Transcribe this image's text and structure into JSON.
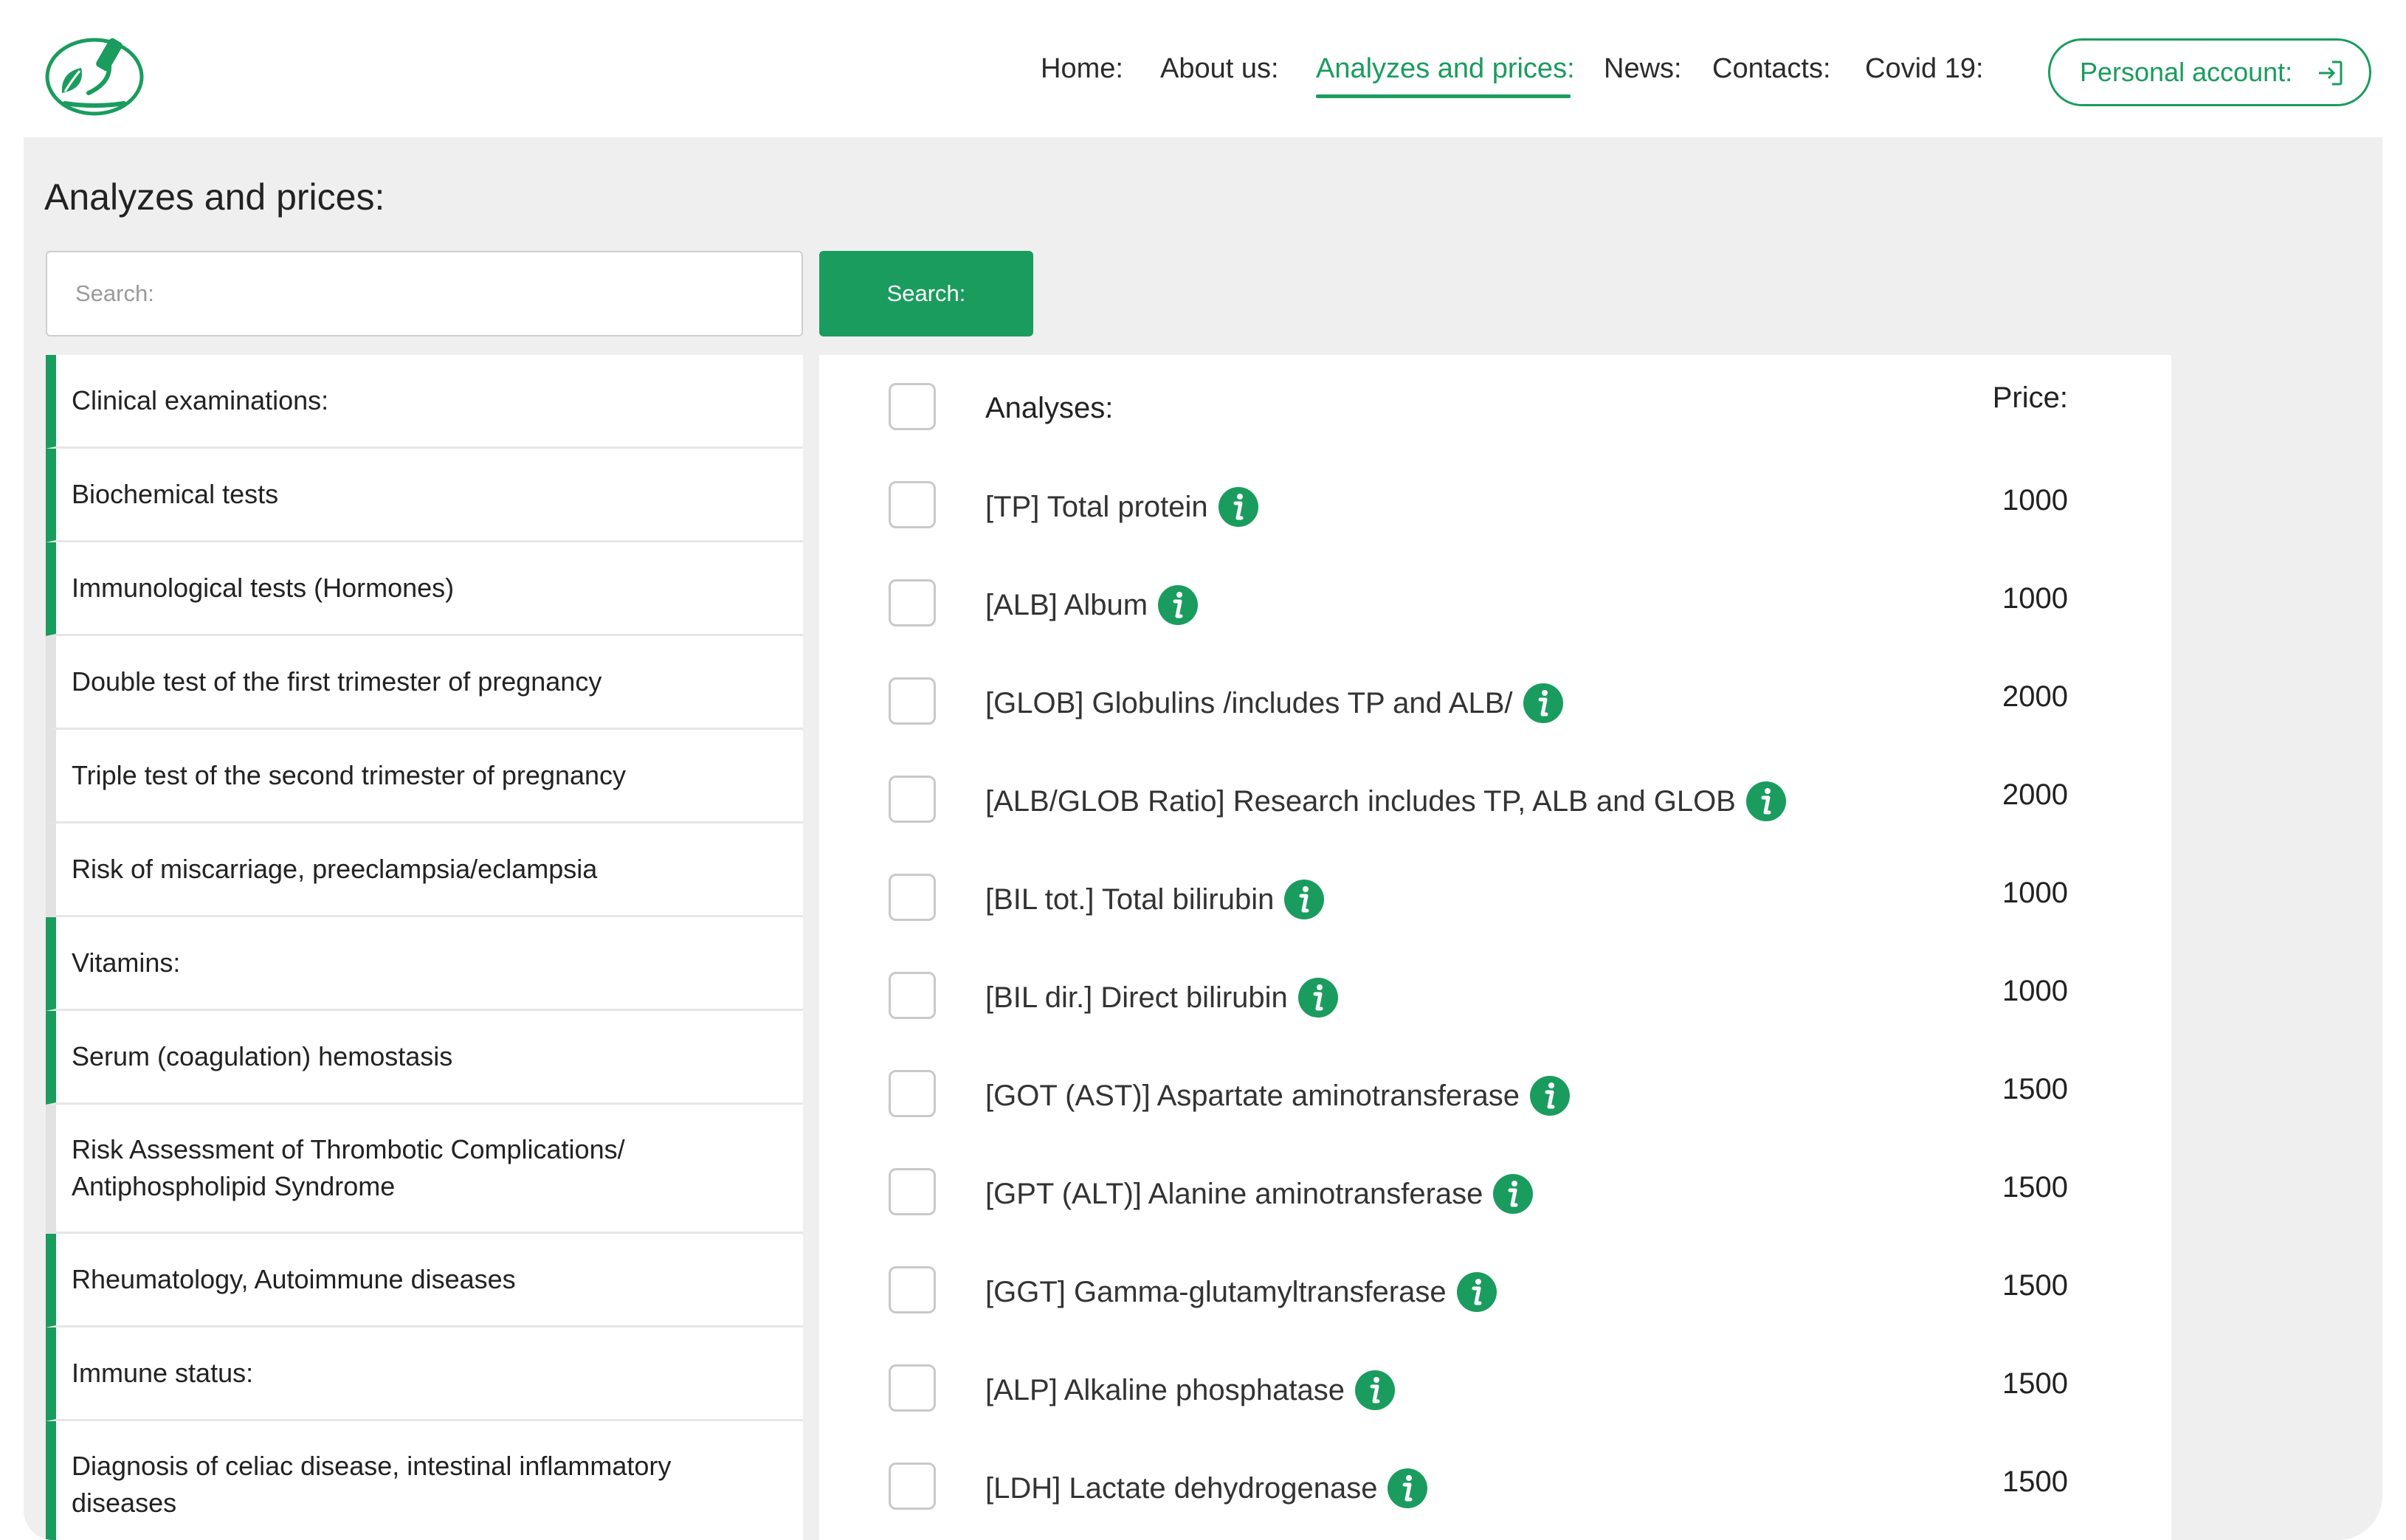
{
  "header": {
    "nav": [
      {
        "label": "Home:",
        "name": "nav-home"
      },
      {
        "label": "About us:",
        "name": "nav-about-us"
      },
      {
        "label": "Analyzes and prices:",
        "name": "nav-analyzes-and-prices"
      },
      {
        "label": "News:",
        "name": "nav-news"
      },
      {
        "label": "Contacts:",
        "name": "nav-contacts"
      },
      {
        "label": "Covid 19:",
        "name": "nav-covid-19"
      }
    ],
    "active_nav": "Analyzes and prices:",
    "account_label": "Personal account:",
    "logo_icon": "microscope-leaf-logo",
    "account_icon": "login-icon"
  },
  "page": {
    "title": "Analyzes and prices:"
  },
  "search": {
    "placeholder": "Search:",
    "value": "",
    "button_label": "Search:"
  },
  "categories": [
    {
      "label": "Clinical examinations:",
      "accent": true
    },
    {
      "label": "Biochemical tests",
      "accent": true
    },
    {
      "label": "Immunological tests (Hormones)",
      "accent": true
    },
    {
      "label": "Double test of the first trimester of pregnancy",
      "accent": false
    },
    {
      "label": "Triple test of the second trimester of pregnancy",
      "accent": false
    },
    {
      "label": "Risk of miscarriage, preeclampsia/eclampsia",
      "accent": false
    },
    {
      "label": "Vitamins:",
      "accent": true
    },
    {
      "label": "Serum (coagulation) hemostasis",
      "accent": true
    },
    {
      "label": "Risk Assessment of Thrombotic Complications/ Antiphospholipid Syndrome",
      "accent": false
    },
    {
      "label": "Rheumatology, Autoimmune diseases",
      "accent": true
    },
    {
      "label": "Immune status:",
      "accent": true
    },
    {
      "label": "Diagnosis of celiac disease, intestinal inflammatory diseases",
      "accent": true
    }
  ],
  "analyses": {
    "header_name": "Analyses:",
    "header_price": "Price:",
    "rows": [
      {
        "name": "[TP] Total protein",
        "price": "1000"
      },
      {
        "name": "[ALB] Album",
        "price": "1000"
      },
      {
        "name": "[GLOB] Globulins /includes TP and ALB/",
        "price": "2000"
      },
      {
        "name": "[ALB/GLOB Ratio] Research includes TP, ALB and GLOB",
        "price": "2000"
      },
      {
        "name": "[BIL tot.] Total bilirubin",
        "price": "1000"
      },
      {
        "name": "[BIL dir.] Direct bilirubin",
        "price": "1000"
      },
      {
        "name": "[GOT (AST)] Aspartate aminotransferase",
        "price": "1500"
      },
      {
        "name": "[GPT (ALT)] Alanine aminotransferase",
        "price": "1500"
      },
      {
        "name": "[GGT] Gamma-glutamyltransferase",
        "price": "1500"
      },
      {
        "name": "[ALP] Alkaline phosphatase",
        "price": "1500"
      },
      {
        "name": "[LDH] Lactate dehydrogenase",
        "price": "1500"
      }
    ],
    "info_icon": "info-icon"
  },
  "colors": {
    "brand_green": "#1a9c5e",
    "panel_bg": "#efefef",
    "inactive_border": "#e2e2e2"
  }
}
